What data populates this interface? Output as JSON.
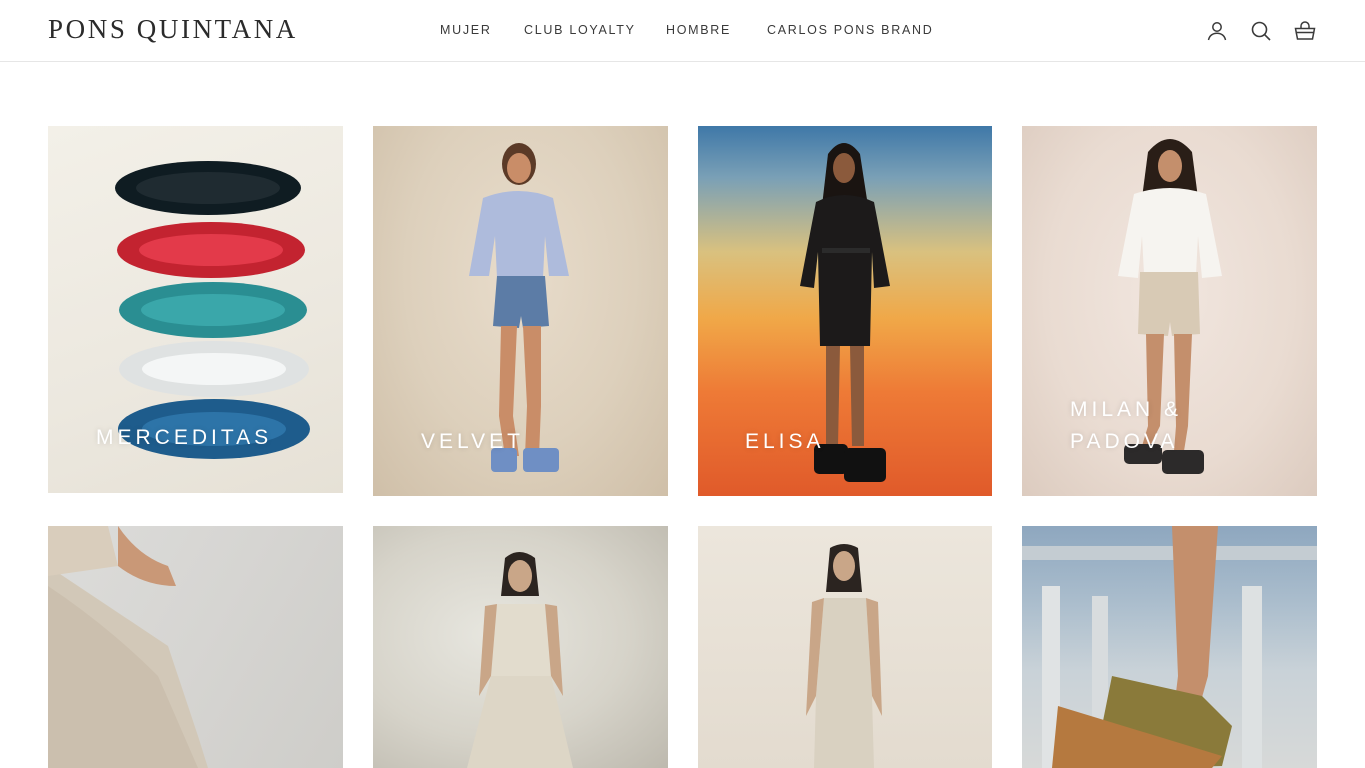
{
  "brand": {
    "logo": "PONS QUINTANA"
  },
  "nav": {
    "items": [
      {
        "label": "MUJER"
      },
      {
        "label": "CLUB LOYALTY"
      },
      {
        "label": "HOMBRE"
      },
      {
        "label": "CARLOS PONS BRAND"
      }
    ]
  },
  "header_icons": [
    "account-icon",
    "search-icon",
    "cart-icon"
  ],
  "grid": {
    "cards": [
      {
        "label": "MERCEDITAS",
        "image": "colorful woven ballet flats stacked"
      },
      {
        "label": "VELVET",
        "image": "model in striped shirt and denim shorts"
      },
      {
        "label": "ELISA",
        "image": "model in black outfit on sunset backdrop"
      },
      {
        "label": "MILAN &\nPADOVA",
        "image": "model in white shirt and beige shorts"
      },
      {
        "label": "",
        "image": "model in linen dress seated"
      },
      {
        "label": "",
        "image": "model in linen top and wide trousers"
      },
      {
        "label": "",
        "image": "model in linen jumpsuit"
      },
      {
        "label": "",
        "image": "wedge sandal close-up in plaza"
      }
    ]
  },
  "colors": {
    "accent": "#2b2b2b",
    "border": "#e6e6e6",
    "label": "#ffffff"
  }
}
